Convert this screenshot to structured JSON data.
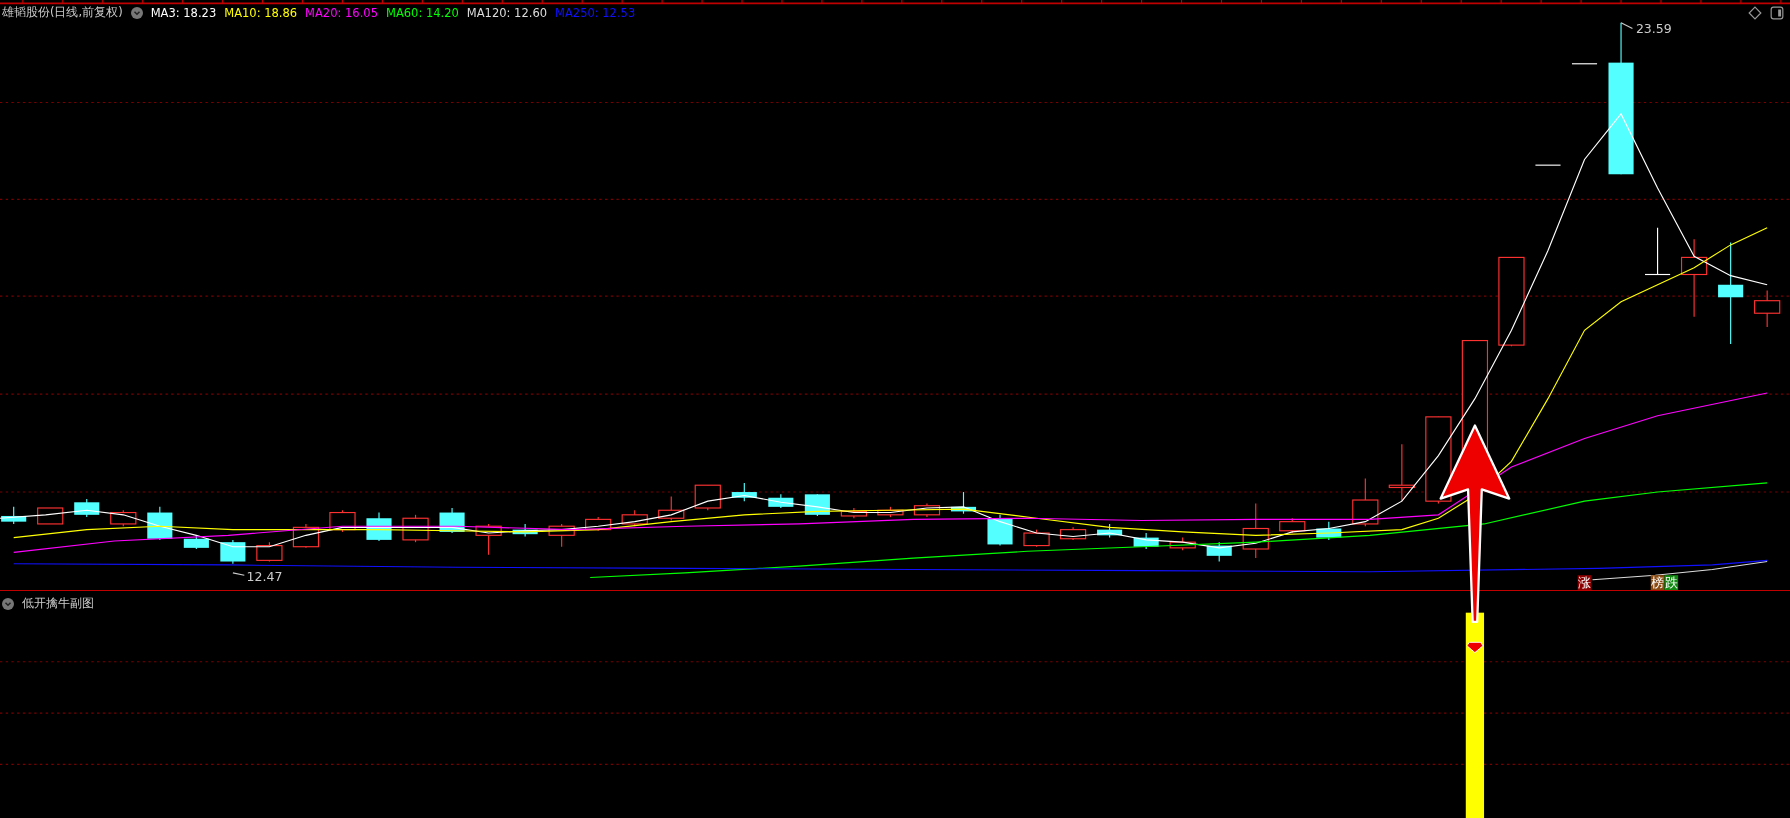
{
  "header": {
    "title": "雄韬股份(日线,前复权)",
    "ma_legend": [
      {
        "label": "MA3: 18.23",
        "color": "#ffffff"
      },
      {
        "label": "MA10: 18.86",
        "color": "#ffff00"
      },
      {
        "label": "MA20: 16.05",
        "color": "#ff00ff"
      },
      {
        "label": "MA60: 14.20",
        "color": "#00ff00"
      },
      {
        "label": "MA120: 12.60",
        "color": "#dcdcdc"
      },
      {
        "label": "MA250: 12.53",
        "color": "#1010ff"
      }
    ]
  },
  "price_labels": {
    "high": "23.59",
    "low": "12.47"
  },
  "signals": [
    {
      "label": "涨",
      "color": "#8b0000"
    },
    {
      "label": "榜",
      "color": "#8b4a10"
    },
    {
      "label": "跌",
      "color": "#108a10"
    }
  ],
  "sub_pane": {
    "title": "低开擒牛副图"
  }
}
